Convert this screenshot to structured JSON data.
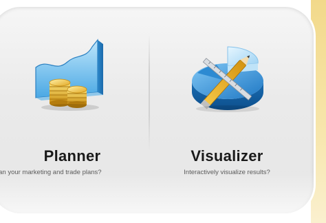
{
  "tools": {
    "planner": {
      "title": "Planner",
      "description": "lan your marketing and trade plans?",
      "icon": "chart-coins-icon"
    },
    "visualizer": {
      "title": "Visualizer",
      "description": "Interactively visualize results?",
      "icon": "pie-chart-tools-icon"
    }
  },
  "colors": {
    "accent_strip": "#f2d98a",
    "panel_background": "#eaeaea",
    "title_text": "#1a1a1a",
    "description_text": "#5a5a5a"
  }
}
